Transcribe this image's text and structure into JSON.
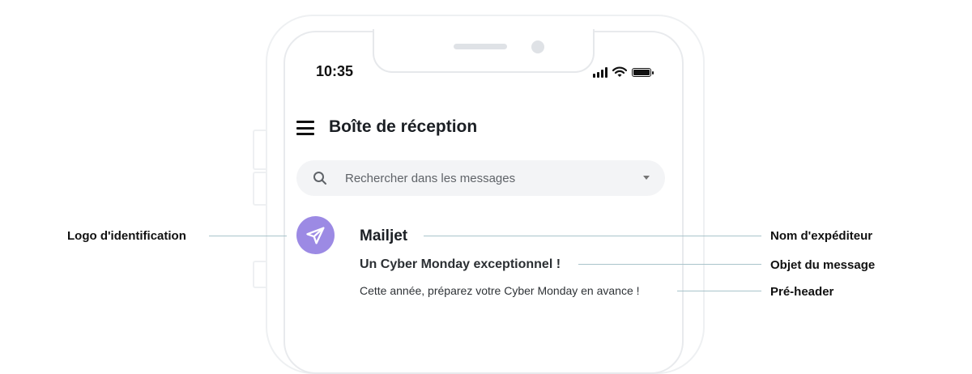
{
  "status_bar": {
    "time": "10:35"
  },
  "header": {
    "title": "Boîte de réception"
  },
  "search": {
    "placeholder": "Rechercher dans les messages"
  },
  "email": {
    "sender": "Mailjet",
    "subject": "Un Cyber Monday exceptionnel !",
    "preheader": "Cette année, préparez votre Cyber Monday en avance !"
  },
  "callouts": {
    "logo": "Logo d'identification",
    "sender_name": "Nom d'expéditeur",
    "subject": "Objet du message",
    "preheader": "Pré-header"
  },
  "colors": {
    "avatar": "#9c8ae4",
    "callout_line": "#a9c4cb",
    "search_bg": "#f3f4f6"
  },
  "icons": [
    "menu-icon",
    "search-icon",
    "caret-down-icon",
    "paper-plane-icon",
    "signal-icon",
    "wifi-icon",
    "battery-icon"
  ]
}
